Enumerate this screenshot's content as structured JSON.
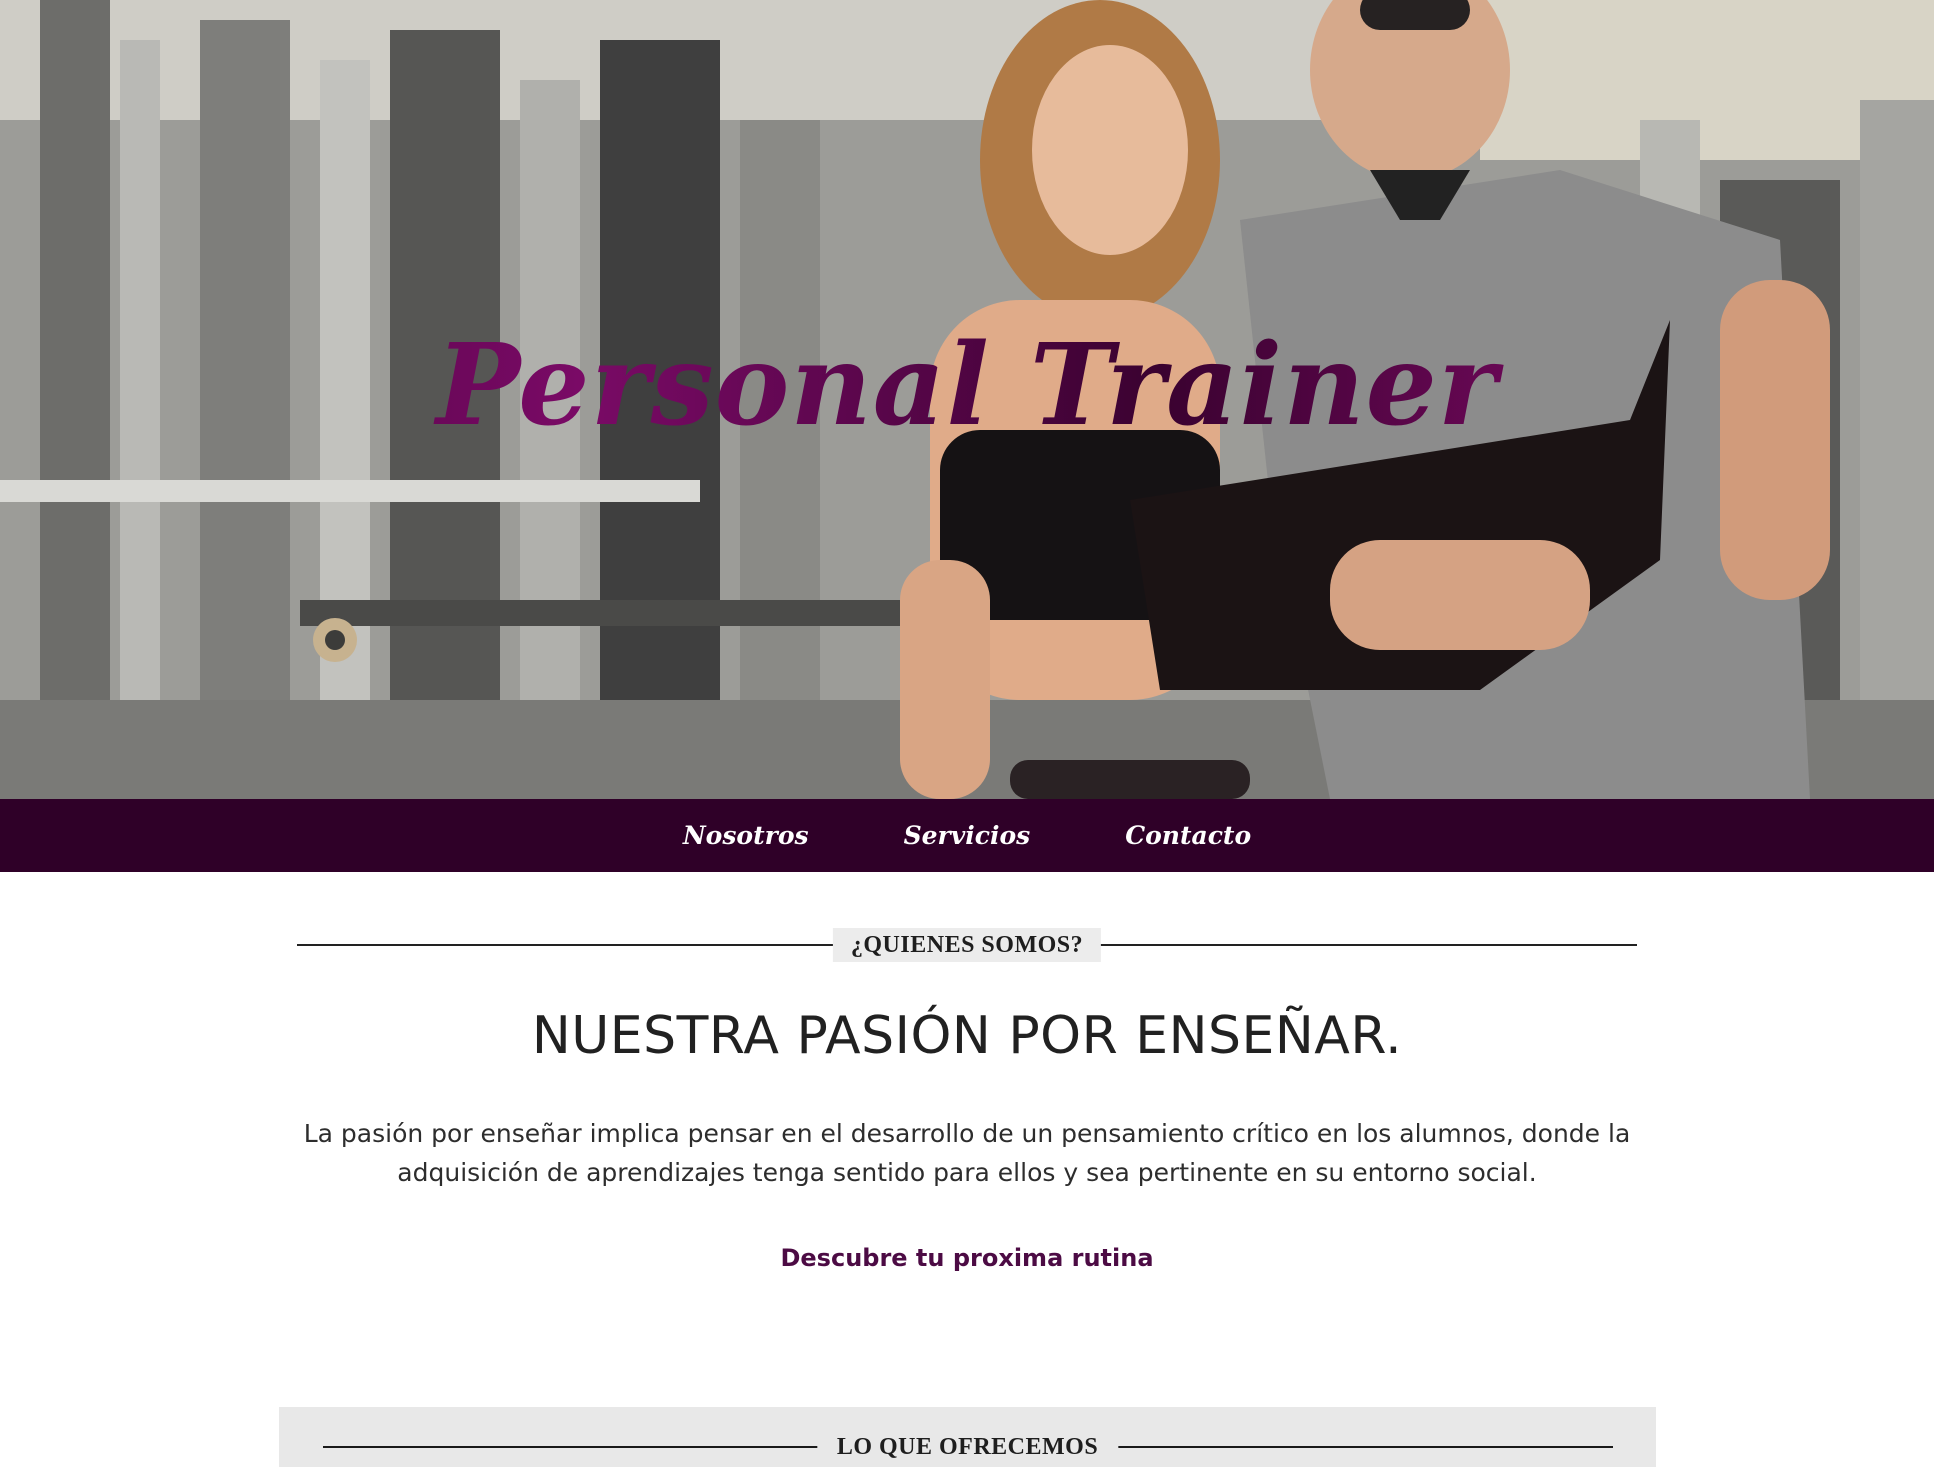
{
  "hero": {
    "title": "Personal Trainer"
  },
  "nav": {
    "items": [
      {
        "label": "Nosotros"
      },
      {
        "label": "Servicios"
      },
      {
        "label": "Contacto"
      }
    ]
  },
  "about": {
    "section_label": "¿QUIENES SOMOS?",
    "heading": "NUESTRA PASIÓN POR ENSEÑAR.",
    "text": "La pasión por enseñar implica pensar en el desarrollo de un pensamiento crítico en los alumnos, donde la adquisición de aprendizajes tenga sentido para ellos y sea pertinente en su entorno social.",
    "cta_label": "Descubre tu proxima rutina"
  },
  "offer": {
    "section_label": "LO QUE OFRECEMOS"
  },
  "colors": {
    "nav_background": "#2f0028",
    "accent": "#5e0a4f",
    "cta": "#4c0b44",
    "offer_background": "#e8e8e8"
  }
}
